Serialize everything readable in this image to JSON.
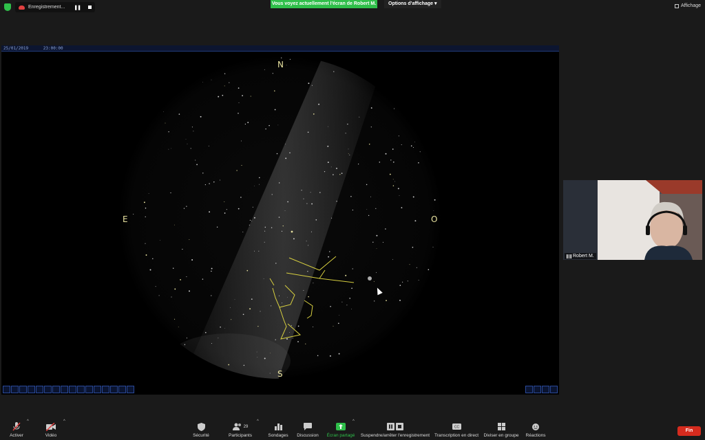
{
  "top_bar": {
    "recording_label": "Enregistrement...",
    "banner_text": "Vous voyez actuellement l'écran de Robert M.",
    "view_options": "Options d'affichage",
    "view_label": "Affichage"
  },
  "shared_screen": {
    "date": "25/01/2019",
    "time": "23:00:00",
    "cardinals": {
      "north": "N",
      "south": "S",
      "east": "E",
      "west": "O"
    }
  },
  "video": {
    "participant_name": "Robert M."
  },
  "toolbar": {
    "mute_label": "Activer",
    "video_label": "Vidéo",
    "security_label": "Sécurité",
    "participants_label": "Participants",
    "participants_count": "29",
    "polls_label": "Sondages",
    "chat_label": "Discussion",
    "share_label": "Écran partagé",
    "record_label": "Suspendre/arrêter l'enregistrement",
    "transcript_label": "Transcription en direct",
    "rooms_label": "Diviser en groupe",
    "reactions_label": "Réactions",
    "end_label": "Fin"
  },
  "colors": {
    "accent_green": "#2fbf4a",
    "end_red": "#d52b1e",
    "constellation_yellow": "#d8d040"
  }
}
